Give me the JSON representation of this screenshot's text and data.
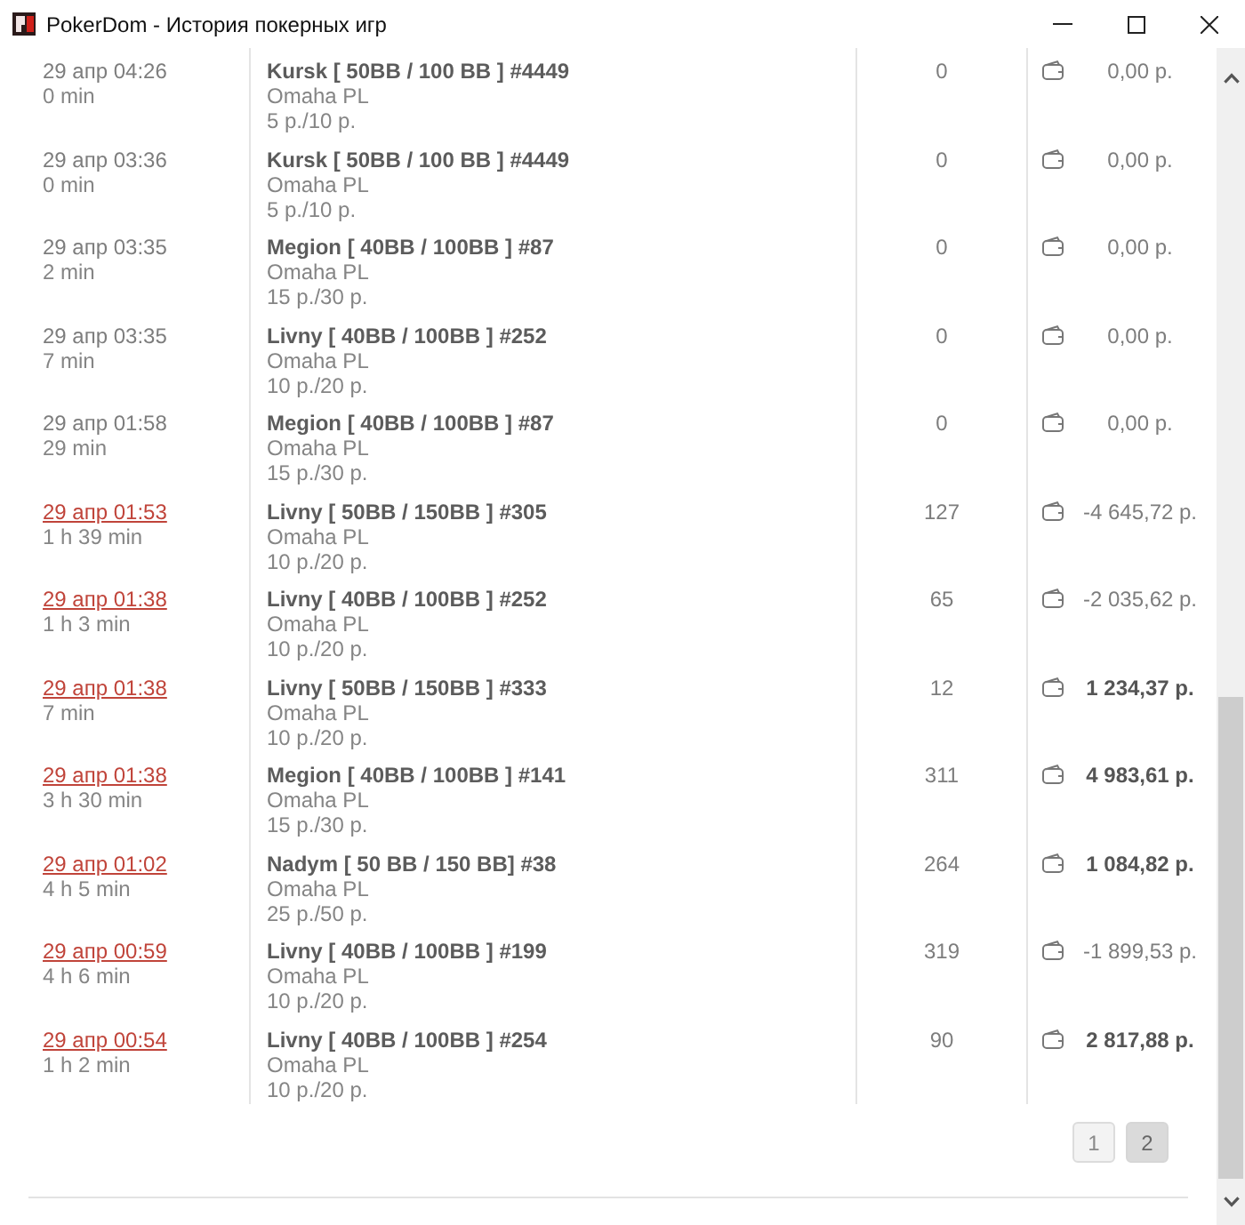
{
  "window": {
    "title": "PokerDom - История покерных игр"
  },
  "games": [
    {
      "date": "29 апр 04:26",
      "date_link": false,
      "duration": "0 min",
      "table": "Kursk [ 50BB / 100 BB ] #4449",
      "game": "Omaha PL",
      "stakes": "5 р./10 р.",
      "hands": "0",
      "result": "0,00 р.",
      "win": false
    },
    {
      "date": "29 апр 03:36",
      "date_link": false,
      "duration": "0 min",
      "table": "Kursk [ 50BB / 100 BB ] #4449",
      "game": "Omaha PL",
      "stakes": "5 р./10 р.",
      "hands": "0",
      "result": "0,00 р.",
      "win": false
    },
    {
      "date": "29 апр 03:35",
      "date_link": false,
      "duration": "2 min",
      "table": "Megion [ 40BB / 100BB ] #87",
      "game": "Omaha PL",
      "stakes": "15 р./30 р.",
      "hands": "0",
      "result": "0,00 р.",
      "win": false
    },
    {
      "date": "29 апр 03:35",
      "date_link": false,
      "duration": "7 min",
      "table": "Livny [ 40BB / 100BB ] #252",
      "game": "Omaha PL",
      "stakes": "10 р./20 р.",
      "hands": "0",
      "result": "0,00 р.",
      "win": false
    },
    {
      "date": "29 апр 01:58",
      "date_link": false,
      "duration": "29 min",
      "table": "Megion [ 40BB / 100BB ] #87",
      "game": "Omaha PL",
      "stakes": "15 р./30 р.",
      "hands": "0",
      "result": "0,00 р.",
      "win": false
    },
    {
      "date": "29 апр 01:53",
      "date_link": true,
      "duration": "1 h 39 min",
      "table": "Livny [ 50BB / 150BB ] #305",
      "game": "Omaha PL",
      "stakes": "10 р./20 р.",
      "hands": "127",
      "result": "-4 645,72 р.",
      "win": false
    },
    {
      "date": "29 апр 01:38",
      "date_link": true,
      "duration": "1 h 3 min",
      "table": "Livny [ 40BB / 100BB ] #252",
      "game": "Omaha PL",
      "stakes": "10 р./20 р.",
      "hands": "65",
      "result": "-2 035,62 р.",
      "win": false
    },
    {
      "date": "29 апр 01:38",
      "date_link": true,
      "duration": "7 min",
      "table": "Livny [ 50BB / 150BB ] #333",
      "game": "Omaha PL",
      "stakes": "10 р./20 р.",
      "hands": "12",
      "result": "1 234,37 р.",
      "win": true
    },
    {
      "date": "29 апр 01:38",
      "date_link": true,
      "duration": "3 h 30 min",
      "table": "Megion [ 40BB / 100BB ] #141",
      "game": "Omaha PL",
      "stakes": "15 р./30 р.",
      "hands": "311",
      "result": "4 983,61 р.",
      "win": true
    },
    {
      "date": "29 апр 01:02",
      "date_link": true,
      "duration": "4 h 5 min",
      "table": "Nadym [ 50 BB / 150 BB] #38",
      "game": "Omaha PL",
      "stakes": "25 р./50 р.",
      "hands": "264",
      "result": "1 084,82 р.",
      "win": true
    },
    {
      "date": "29 апр 00:59",
      "date_link": true,
      "duration": "4 h 6 min",
      "table": "Livny [ 40BB / 100BB ] #199",
      "game": "Omaha PL",
      "stakes": "10 р./20 р.",
      "hands": "319",
      "result": "-1 899,53 р.",
      "win": false
    },
    {
      "date": "29 апр 00:54",
      "date_link": true,
      "duration": "1 h 2 min",
      "table": "Livny [ 40BB / 100BB ] #254",
      "game": "Omaha PL",
      "stakes": "10 р./20 р.",
      "hands": "90",
      "result": "2 817,88 р.",
      "win": true
    }
  ],
  "pagination": [
    {
      "label": "1",
      "selected": false
    },
    {
      "label": "2",
      "selected": true
    }
  ]
}
